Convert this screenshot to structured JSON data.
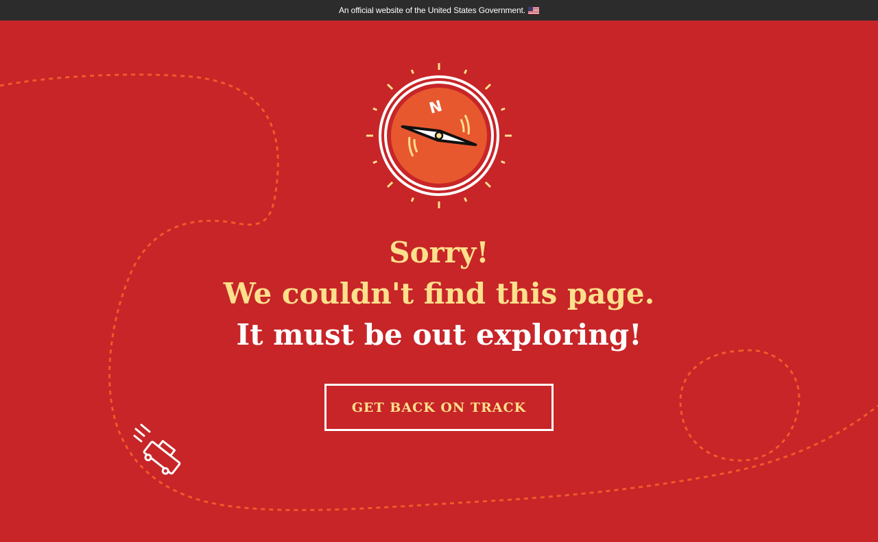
{
  "banner": {
    "text": "An official website of the United States Government.",
    "flag_icon": "us-flag-icon"
  },
  "message": {
    "line1": "Sorry!",
    "line2": "We couldn't find this page.",
    "line3": "It must be out exploring!"
  },
  "button": {
    "label": "GET BACK ON TRACK"
  },
  "compass": {
    "letter": "N"
  },
  "colors": {
    "background": "#c72528",
    "banner": "#2c2c2c",
    "accent_yellow": "#fde08c",
    "compass_orange": "#e8582f",
    "path_orange": "#ee5a2a",
    "white": "#ffffff"
  },
  "icons": [
    "us-flag-icon",
    "compass-icon",
    "jeep-icon"
  ]
}
